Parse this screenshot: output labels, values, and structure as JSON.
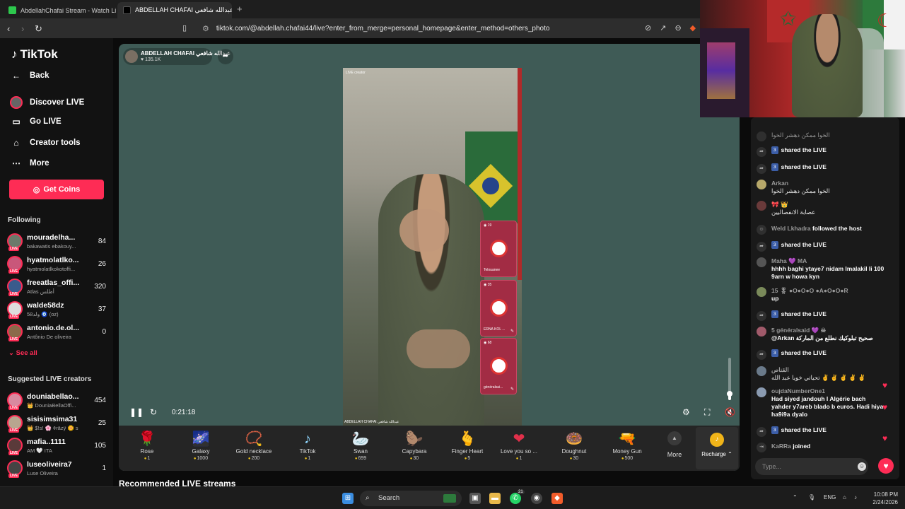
{
  "browser": {
    "tabs": [
      {
        "title": "AbdellahChafai Stream - Watch Live o",
        "favicon_color": "#2dc84d"
      },
      {
        "title": "ABDELLAH CHAFAI عبدالله شافعي",
        "favicon_color": "#000000"
      }
    ],
    "new_tab": "+",
    "url": "tiktok.com/@abdellah.chafai44/live?enter_from_merge=personal_homepage&enter_method=others_photo"
  },
  "sidebar": {
    "logo": "TikTok",
    "nav": [
      {
        "label": "Back",
        "icon": "back-arrow-icon"
      },
      {
        "label": "Discover LIVE",
        "icon": "discover-live-icon"
      },
      {
        "label": "Go LIVE",
        "icon": "video-camera-icon"
      },
      {
        "label": "Creator tools",
        "icon": "home-icon"
      },
      {
        "label": "More",
        "icon": "more-dots-icon"
      }
    ],
    "get_coins": "Get Coins",
    "following_title": "Following",
    "following": [
      {
        "name": "mouradelha...",
        "sub": "bakawatis ebakouy...",
        "count": "84"
      },
      {
        "name": "hyatmolatlko...",
        "sub": "hyatmolatlkokotoffi...",
        "count": "26"
      },
      {
        "name": "freeatlas_offi...",
        "sub": "Atlas أطلس",
        "count": "320"
      },
      {
        "name": "walde58dz",
        "sub": "58ولد 🧿 (oz)",
        "count": "37"
      },
      {
        "name": "antonio.de.ol...",
        "sub": "Antônio De oliveira",
        "count": "0"
      }
    ],
    "see_all": "See all",
    "suggested_title": "Suggested LIVE creators",
    "suggested": [
      {
        "name": "douniabellao...",
        "sub": "👑 DouniaBellaOffi...",
        "count": "454"
      },
      {
        "name": "sisisimsima31",
        "sub": "👑 $!s! 🌸 ¢rāzÿ 🌼 s",
        "count": "25"
      },
      {
        "name": "mafia..1111",
        "sub": "AM 🤍 ITA",
        "count": "105"
      },
      {
        "name": "luseoliveira7",
        "sub": "Luse Oliveira",
        "count": "1"
      }
    ],
    "live_tag": "LIVE"
  },
  "stage": {
    "host_name": "ABDELLAH CHAFAI عبدالله شافعي",
    "host_likes": "135.1K",
    "video_label": "LIVE creator",
    "video_bottom": "ABDELLAH CHAFAI عبدالله شافعي",
    "guests": [
      {
        "top": "19",
        "name": "Telouanee"
      },
      {
        "top": "35",
        "name": "ERNA KOL ..."
      },
      {
        "top": "68",
        "name": "généralsai..."
      }
    ],
    "timecode": "0:21:18",
    "volume_fraction": 0.15
  },
  "gifts": [
    {
      "name": "Rose",
      "price": "1",
      "icon": "🌹"
    },
    {
      "name": "Galaxy",
      "price": "1000",
      "icon": "🌌"
    },
    {
      "name": "Gold necklace",
      "price": "200",
      "icon": "📿"
    },
    {
      "name": "TikTok",
      "price": "1",
      "icon": "♪"
    },
    {
      "name": "Swan",
      "price": "699",
      "icon": "🦢"
    },
    {
      "name": "Capybara",
      "price": "30",
      "icon": "🦫"
    },
    {
      "name": "Finger Heart",
      "price": "5",
      "icon": "🫰"
    },
    {
      "name": "Love you so ...",
      "price": "1",
      "icon": "❤"
    },
    {
      "name": "Doughnut",
      "price": "30",
      "icon": "🍩"
    },
    {
      "name": "Money Gun",
      "price": "500",
      "icon": "🔫"
    }
  ],
  "gift_more": "More",
  "recharge": "Recharge",
  "recommended_title": "Recommended LIVE streams",
  "chat": {
    "messages": [
      {
        "kind": "text",
        "user": "",
        "text": "الخوا ممكن دهشر الخوا"
      },
      {
        "kind": "share",
        "badge": "3",
        "text": "shared the LIVE"
      },
      {
        "kind": "share",
        "badge": "3",
        "text": "shared the LIVE"
      },
      {
        "kind": "text",
        "user": "Arkan",
        "text": "الخوا ممكن دهشر الخوا"
      },
      {
        "kind": "text",
        "user": "🎀 👑",
        "text": "عصابة الانفصاليين"
      },
      {
        "kind": "follow",
        "user": "Weld Lkhadra",
        "text": "followed the host"
      },
      {
        "kind": "share",
        "badge": "3",
        "text": "shared the LIVE"
      },
      {
        "kind": "text",
        "user": "Maha 💜 MA",
        "text": "hhhh baghi ytaye7 nidam lmalakil li 100 9arn w howa kyn"
      },
      {
        "kind": "text",
        "user": "15 🎖 ●O●O●O ●A●O●O●R",
        "text": "up"
      },
      {
        "kind": "share",
        "badge": "3",
        "text": "shared the LIVE"
      },
      {
        "kind": "text",
        "user": "5 généralsaid 💜 ☠",
        "text": "@Arkan صحيح تبلوكيك نطلع من الماركة"
      },
      {
        "kind": "share",
        "badge": "3",
        "text": "shared the LIVE"
      },
      {
        "kind": "text",
        "user": "القناص",
        "text": "تحياتي خويا عبد الله ✌ ✌ ✌ ✌ ✌"
      },
      {
        "kind": "text",
        "user": "oujdaNumberOne1",
        "text": "Had siyed jandouh l Algérie bach yahder y7areb blado b euros. Hadi hiya ha9i9a dyalo"
      },
      {
        "kind": "share",
        "badge": "3",
        "text": "shared the LIVE"
      },
      {
        "kind": "join",
        "user": "KaRRa",
        "text": "joined"
      }
    ],
    "input_placeholder": "Type..."
  },
  "taskbar": {
    "search": "Search",
    "lang": "ENG",
    "time": "10:08 PM",
    "date": "2/24/2026",
    "whatsapp_badge": "21"
  },
  "colors": {
    "accent": "#fe2c55",
    "stage_bg": "#3f5b56",
    "coin": "#f0c419"
  }
}
